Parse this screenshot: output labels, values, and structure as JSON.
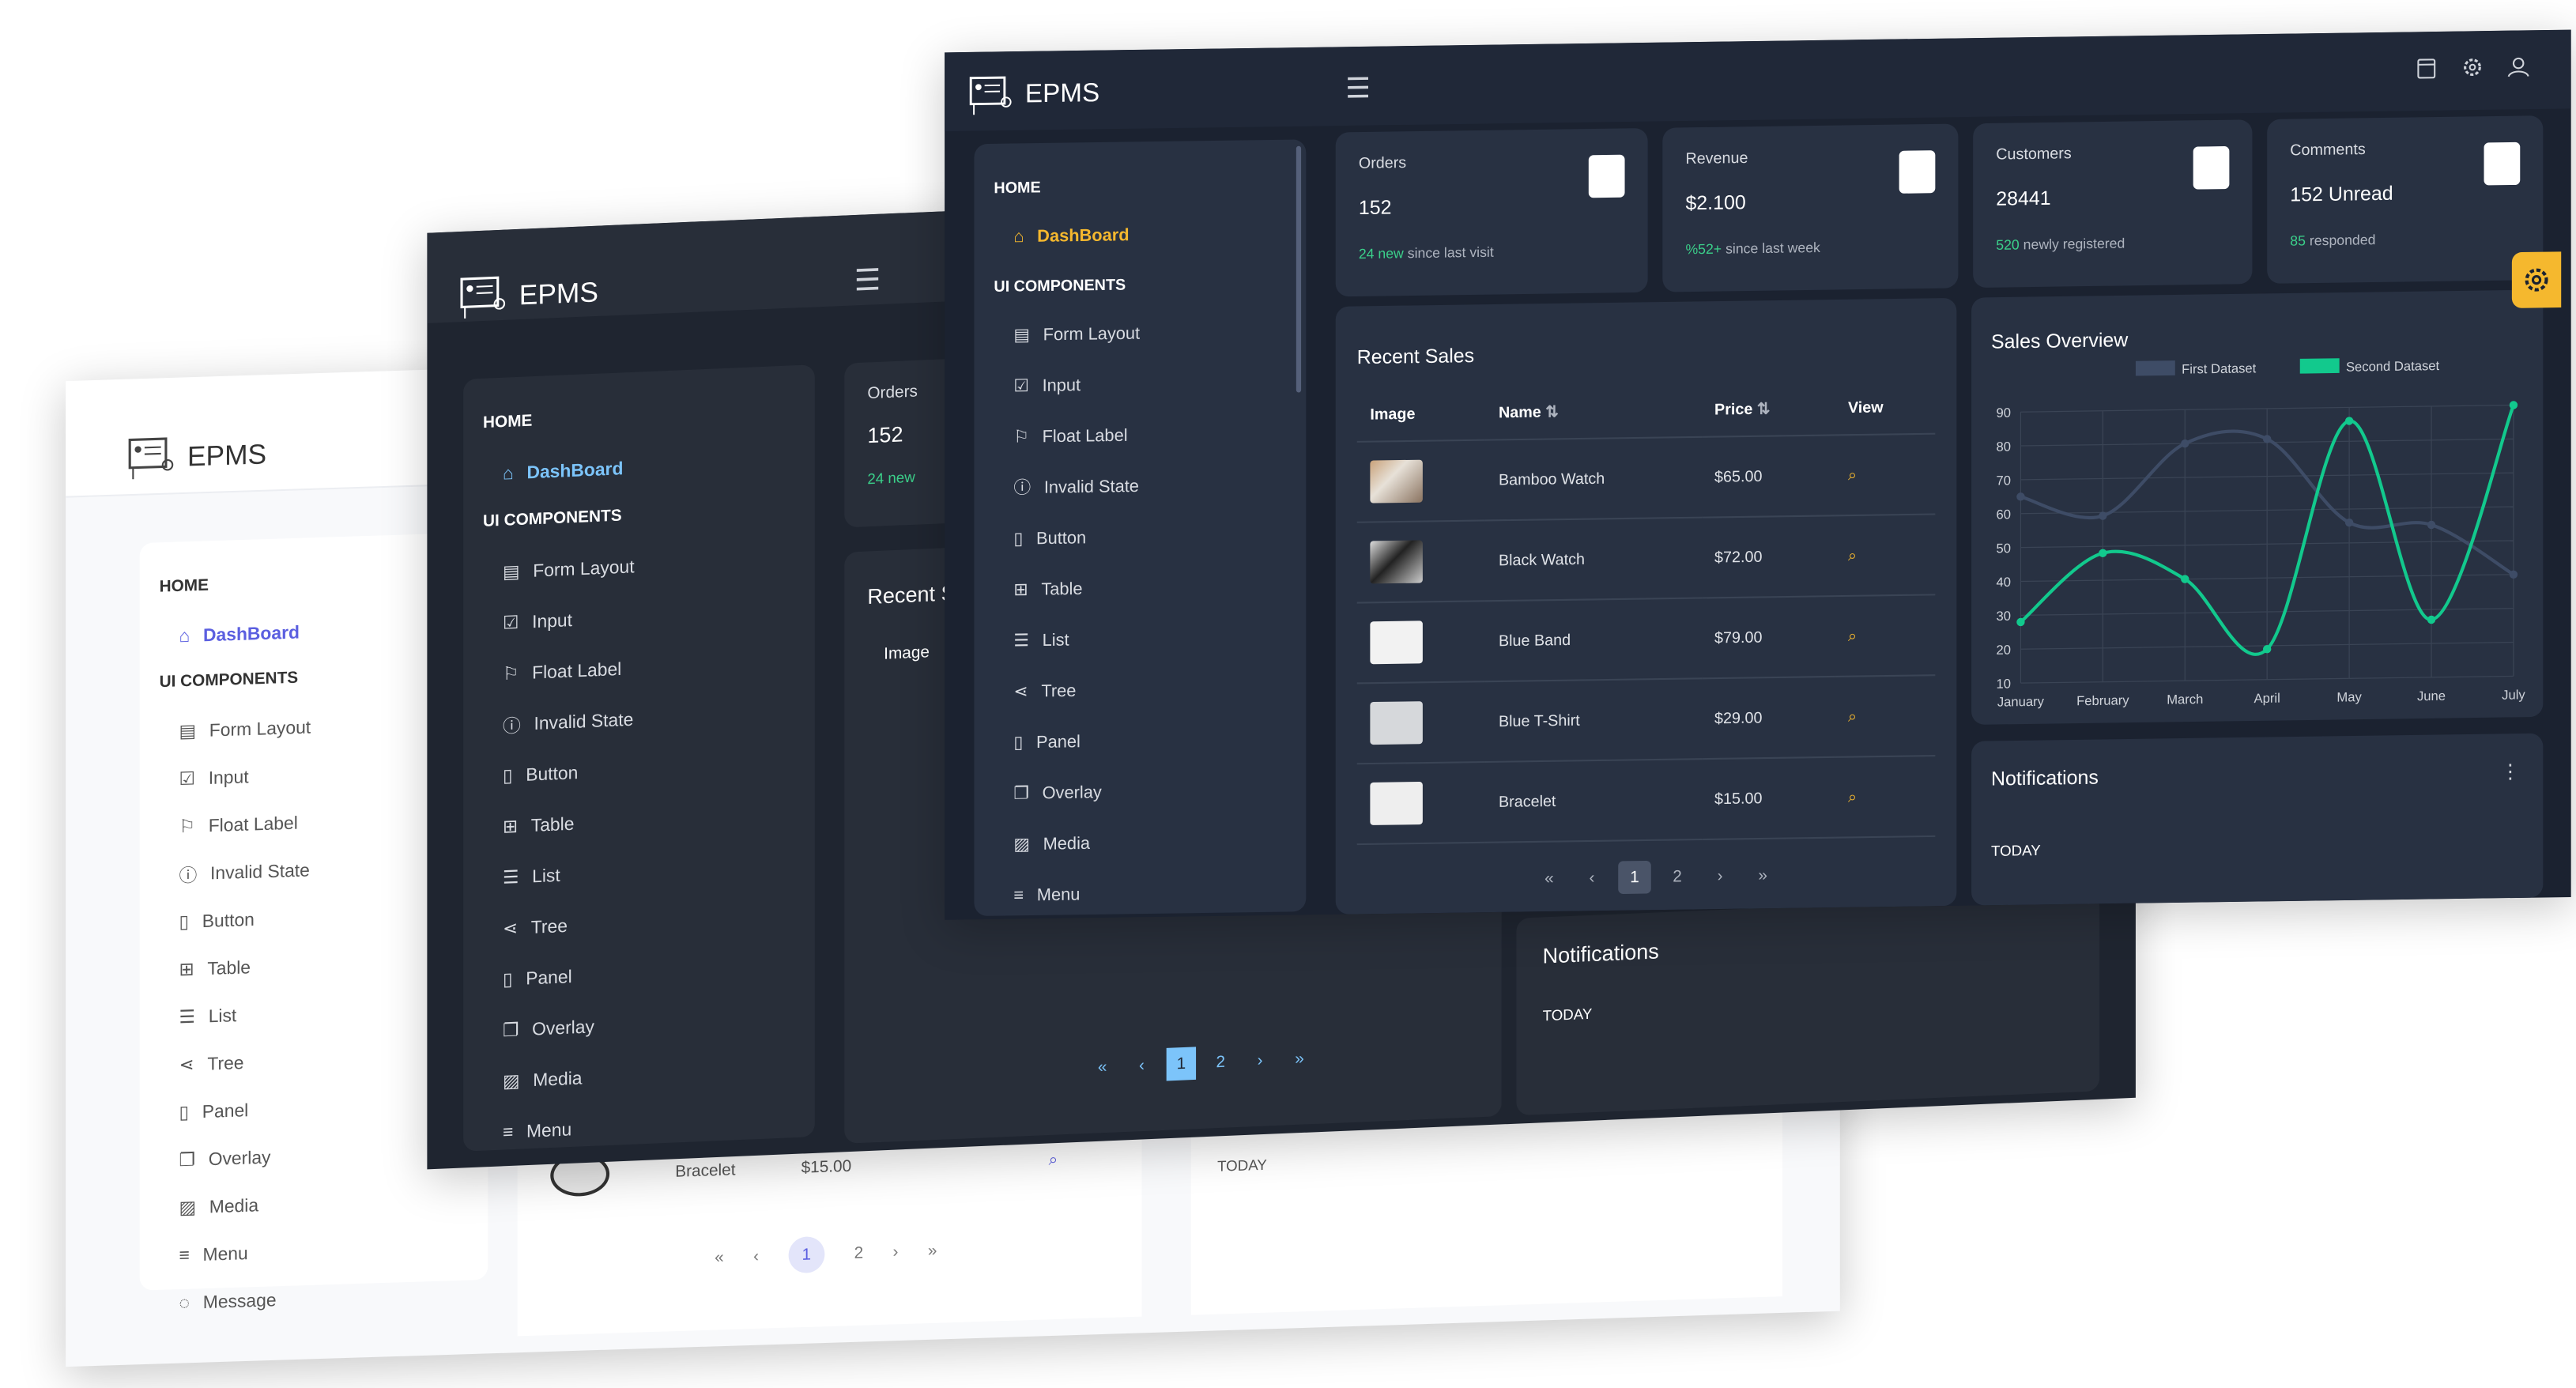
{
  "brand": "EPMS",
  "menu": {
    "home_header": "HOME",
    "dashboard": "DashBoard",
    "ui_header": "UI COMPONENTS",
    "items": [
      "Form Layout",
      "Input",
      "Float Label",
      "Invalid State",
      "Button",
      "Table",
      "List",
      "Tree",
      "Panel",
      "Overlay",
      "Media",
      "Menu",
      "Message"
    ]
  },
  "cards": {
    "orders": {
      "label": "Orders",
      "value": "152",
      "highlight": "24 new",
      "suffix": "since last visit"
    },
    "revenue": {
      "label": "Revenue",
      "value": "$2.100",
      "highlight": "%52+",
      "suffix": "since last week"
    },
    "customers": {
      "label": "Customers",
      "value": "28441",
      "highlight": "520",
      "suffix": "newly registered"
    },
    "comments": {
      "label": "Comments",
      "value": "152 Unread",
      "highlight": "85",
      "suffix": "responded"
    }
  },
  "recent_sales": {
    "title": "Recent Sales",
    "title_cut": "Recent S",
    "columns": {
      "image": "Image",
      "name": "Name",
      "price": "Price",
      "view": "View"
    },
    "rows": [
      {
        "name": "Bamboo Watch",
        "price": "$65.00"
      },
      {
        "name": "Black Watch",
        "price": "$72.00"
      },
      {
        "name": "Blue Band",
        "price": "$79.00"
      },
      {
        "name": "Blue T-Shirt",
        "price": "$29.00"
      },
      {
        "name": "Bracelet",
        "price": "$15.00"
      }
    ],
    "pages": [
      "1",
      "2"
    ]
  },
  "chart": {
    "title": "Sales Overview",
    "months_cut": [
      "January",
      "February",
      "March",
      "April",
      "May",
      "June",
      "July"
    ]
  },
  "chart_data": {
    "type": "line",
    "title": "Sales Overview",
    "categories": [
      "January",
      "February",
      "March",
      "April",
      "May",
      "June",
      "July"
    ],
    "series": [
      {
        "name": "First Dataset",
        "values": [
          65,
          59,
          80,
          81,
          56,
          55,
          40
        ],
        "color": "#3e4c66"
      },
      {
        "name": "Second Dataset",
        "values": [
          28,
          48,
          40,
          19,
          86,
          27,
          90
        ],
        "color": "#12c98d"
      }
    ],
    "ylim": [
      10,
      90
    ],
    "yticks": [
      "10",
      "20",
      "30",
      "40",
      "50",
      "60",
      "70",
      "80",
      "90"
    ],
    "legend": "top"
  },
  "notifications": {
    "title": "Notifications",
    "today": "TODAY"
  },
  "colors": {
    "accent_gold": "#f5b82e",
    "accent_blue": "#7cc4fa",
    "accent_purple": "#5b5fe0",
    "success": "#3bd08a"
  }
}
